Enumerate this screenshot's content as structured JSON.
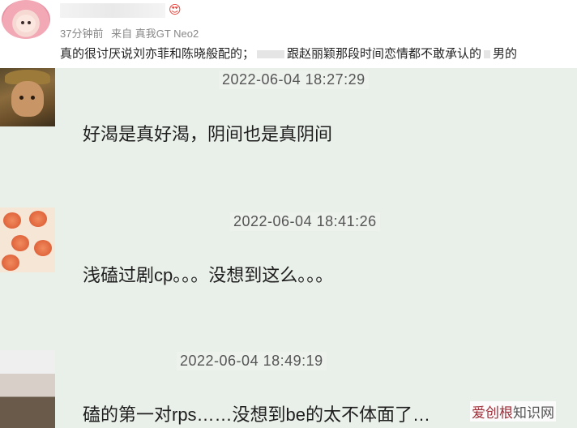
{
  "post": {
    "emoji": "😍",
    "time_ago": "37分钟前",
    "source": "来自 真我GT Neo2",
    "comment_part1": "真的很讨厌说刘亦菲和陈晓般配的；",
    "comment_part2": "跟赵丽颖那段时间恋情都不敢承认的",
    "comment_part3": "男的"
  },
  "chat": {
    "messages": [
      {
        "time": "2022-06-04 18:27:29",
        "text": "好渴是真好渴，阴间也是真阴间"
      },
      {
        "time": "2022-06-04 18:41:26",
        "text": "浅磕过剧cp。。。没想到这么。。。"
      },
      {
        "time": "2022-06-04 18:49:19",
        "text": "磕的第一对rps……没想到be的太不体面了…"
      }
    ]
  },
  "watermark": {
    "brand": "爱创根",
    "suffix": "知识网"
  },
  "colors": {
    "chat_bg": "#e9efe9",
    "text": "#1e1e1e",
    "time": "#555555",
    "meta": "#888888"
  }
}
